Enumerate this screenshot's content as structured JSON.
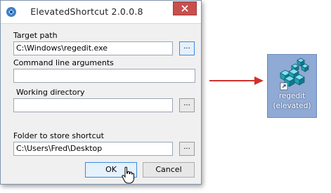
{
  "window": {
    "title": "ElevatedShortcut 2.0.0.8"
  },
  "form": {
    "target_path_label": "Target path",
    "target_path_value": "C:\\Windows\\regedit.exe",
    "arguments_label": "Command line arguments",
    "arguments_value": "",
    "working_dir_label": "Working directory",
    "working_dir_value": "",
    "folder_label": "Folder to store shortcut",
    "folder_value": "C:\\Users\\Fred\\Desktop",
    "browse_label": "..."
  },
  "buttons": {
    "ok_label": "OK",
    "cancel_label": "Cancel"
  },
  "shortcut": {
    "line1": "regedit",
    "line2": "(elevated)"
  },
  "colors": {
    "close_button": "#c7504d",
    "arrow": "#d0312d",
    "shortcut_bg": "#8faad4"
  }
}
